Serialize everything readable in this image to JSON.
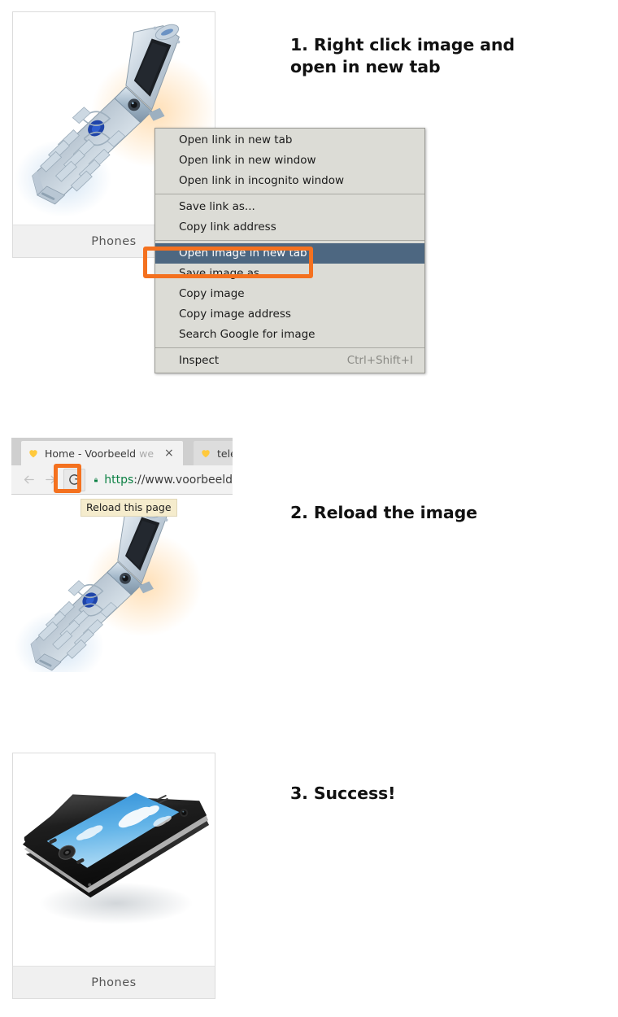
{
  "steps": [
    {
      "id": "step-1",
      "title": "1. Right click image and open in new tab"
    },
    {
      "id": "step-2",
      "title": "2. Reload the image"
    },
    {
      "id": "step-3",
      "title": "3. Success!"
    }
  ],
  "cards": [
    {
      "id": "card-flip-phone",
      "caption": "Phones",
      "image_alt": "flip-phone"
    },
    {
      "id": "card-smartphone",
      "caption": "Phones",
      "image_alt": "smartphone"
    }
  ],
  "context_menu": {
    "groups": [
      {
        "items": [
          {
            "label": "Open link in new tab",
            "selected": false,
            "shortcut": ""
          },
          {
            "label": "Open link in new window",
            "selected": false,
            "shortcut": ""
          },
          {
            "label": "Open link in incognito window",
            "selected": false,
            "shortcut": ""
          }
        ]
      },
      {
        "items": [
          {
            "label": "Save link as...",
            "selected": false,
            "shortcut": ""
          },
          {
            "label": "Copy link address",
            "selected": false,
            "shortcut": ""
          }
        ]
      },
      {
        "items": [
          {
            "label": "Open image in new tab",
            "selected": true,
            "shortcut": ""
          },
          {
            "label": "Save image as...",
            "selected": false,
            "shortcut": ""
          },
          {
            "label": "Copy image",
            "selected": false,
            "shortcut": ""
          },
          {
            "label": "Copy image address",
            "selected": false,
            "shortcut": ""
          },
          {
            "label": "Search Google for image",
            "selected": false,
            "shortcut": ""
          }
        ]
      },
      {
        "items": [
          {
            "label": "Inspect",
            "selected": false,
            "shortcut": "Ctrl+Shift+I"
          }
        ]
      }
    ]
  },
  "browser": {
    "tabs": [
      {
        "title": "Home - Voorbeeld",
        "title_faded": "we",
        "active": true,
        "close_label": "×",
        "favicon": "heart-icon"
      },
      {
        "title": "telefo",
        "title_faded": "",
        "active": false,
        "close_label": "",
        "favicon": "heart-icon"
      }
    ],
    "toolbar": {
      "back_label": "←",
      "forward_label": "→",
      "reload_label": "↻",
      "lock_icon": "lock-icon",
      "url_scheme": "https",
      "url_rest": "://www.voorbeeld"
    },
    "tooltip": "Reload this page"
  },
  "colors": {
    "highlight_orange": "#f4711f",
    "menu_selected_blue": "#4d6781",
    "menu_bg": "#dcdcd6",
    "card_border": "#dcdcdc",
    "caption_bg": "#f0f0f0",
    "lock_green": "#0b8043",
    "favicon_yellow": "#ffc93c"
  }
}
